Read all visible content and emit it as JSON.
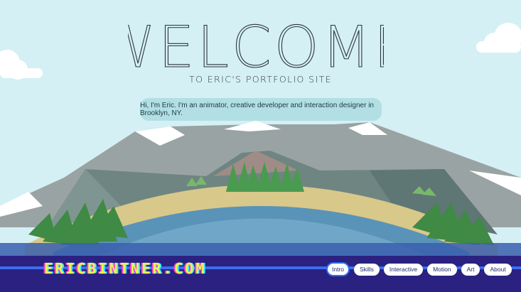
{
  "hero": {
    "welcome_title": "WELCOME",
    "subtitle": "TO ERIC'S PORTFOLIO SITE",
    "intro_text": "Hi, I'm Eric. I'm an animator, creative developer and interaction designer in Brooklyn, NY."
  },
  "footer": {
    "logo_text": "ERICBINTNER.COM",
    "nav": [
      {
        "label": "Intro",
        "active": true
      },
      {
        "label": "Skills",
        "active": false
      },
      {
        "label": "Interactive",
        "active": false
      },
      {
        "label": "Motion",
        "active": false
      },
      {
        "label": "Art",
        "active": false
      },
      {
        "label": "About",
        "active": false
      }
    ]
  },
  "colors": {
    "sky": "#d4f0f5",
    "footer_bg": "#2b2180",
    "footer_accent": "#3d6df0",
    "logo_fill": "#e8f558",
    "mountain_dark": "#6f8582",
    "mountain_light": "#9aa3a3",
    "grass": "#4a8a48",
    "sand": "#d8c88a",
    "water": "#5a93b8"
  }
}
